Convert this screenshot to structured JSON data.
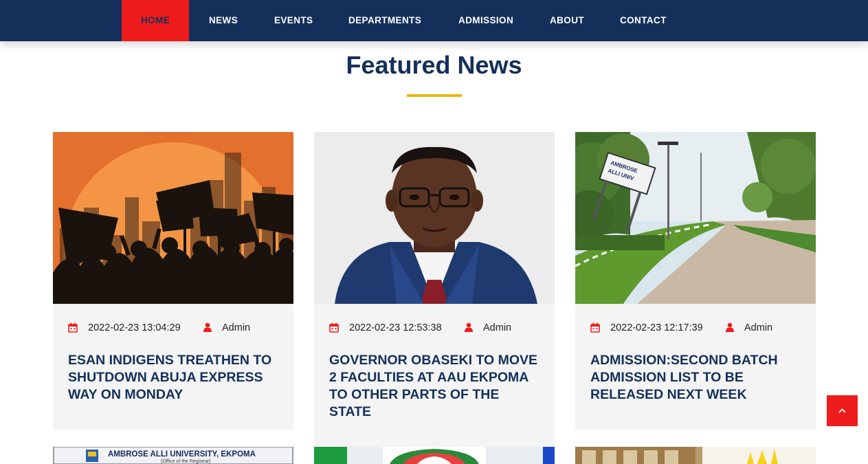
{
  "nav": {
    "items": [
      "HOME",
      "NEWS",
      "EVENTS",
      "DEPARTMENTS",
      "ADMISSION",
      "ABOUT",
      "CONTACT"
    ],
    "active": "HOME"
  },
  "section": {
    "title": "Featured News"
  },
  "cards": [
    {
      "date": "2022-02-23 13:04:29",
      "author": "Admin",
      "title": "ESAN INDIGENS TREATHEN TO SHUTDOWN ABUJA EXPRESS WAY ON MONDAY"
    },
    {
      "date": "2022-02-23 12:53:38",
      "author": "Admin",
      "title": "GOVERNOR OBASEKI TO MOVE 2 FACULTIES AT AAU EKPOMA TO OTHER PARTS OF THE STATE"
    },
    {
      "date": "2022-02-23 12:17:39",
      "author": "Admin",
      "title": "ADMISSION:SECOND BATCH ADMISSION LIST TO BE RELEASED NEXT WEEK"
    }
  ],
  "next_row": {
    "card1_banner": "AMBROSE ALLI UNIVERSITY, EKPOMA",
    "card1_sub": "(Office of the Registrar)"
  },
  "colors": {
    "navy": "#14305a",
    "red": "#ee1c1c",
    "gold": "#f0b70c"
  }
}
